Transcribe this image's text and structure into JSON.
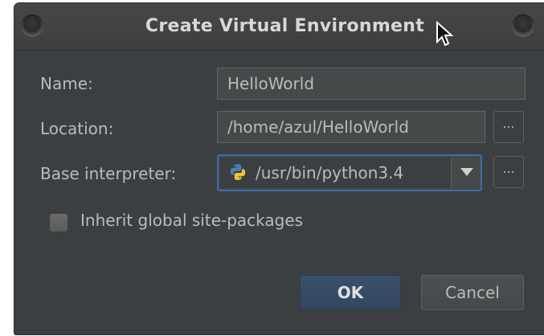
{
  "dialog": {
    "title": "Create Virtual Environment"
  },
  "form": {
    "name_label": "Name:",
    "name_value": "HelloWorld",
    "location_label": "Location:",
    "location_value": "/home/azul/HelloWorld",
    "location_browse": "...",
    "interpreter_label": "Base interpreter:",
    "interpreter_value": "/usr/bin/python3.4",
    "interpreter_browse": "...",
    "inherit_label": "Inherit global site-packages",
    "inherit_checked": false
  },
  "buttons": {
    "ok": "OK",
    "cancel": "Cancel"
  },
  "colors": {
    "background": "#3c3f41",
    "focus_border": "#3d6eaa",
    "text": "#bbbbbb"
  }
}
